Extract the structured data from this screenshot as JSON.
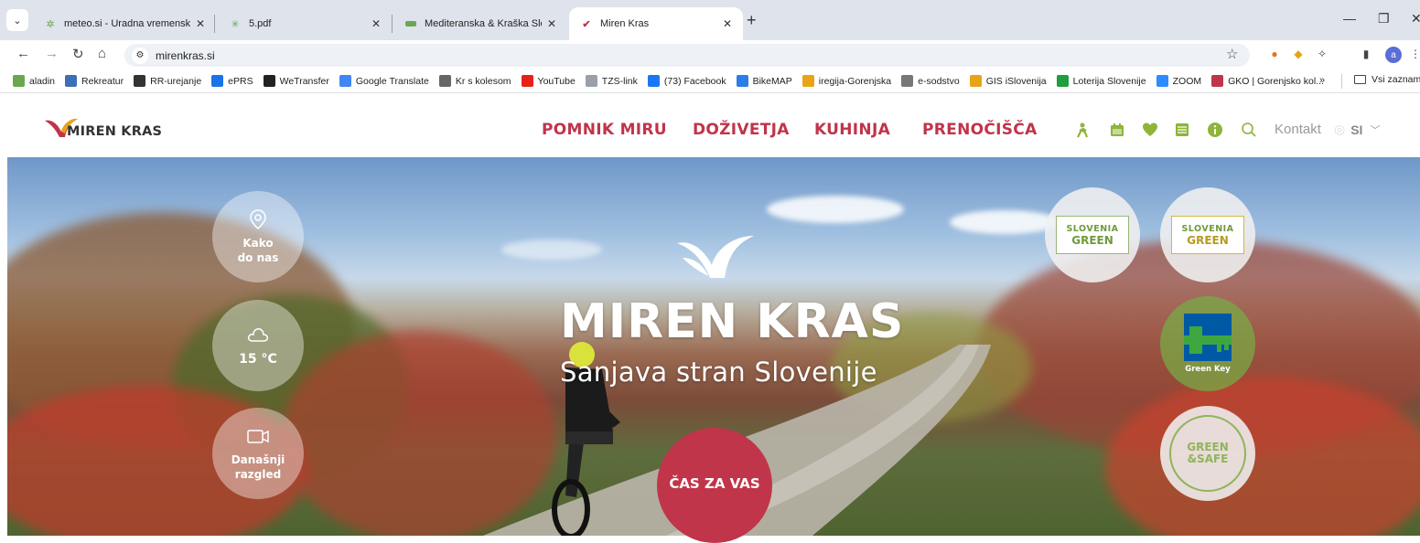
{
  "browser": {
    "tabs": [
      {
        "title": "meteo.si - Uradna vremenska n",
        "icon": "meteo-favicon"
      },
      {
        "title": "5.pdf",
        "icon": "pdf-favicon"
      },
      {
        "title": "Mediteranska & Kraška Sloven",
        "icon": "slovenia-favicon"
      },
      {
        "title": "Miren Kras",
        "icon": "miren-kras-favicon"
      }
    ],
    "url": "mirenkras.si",
    "bookmarks": [
      {
        "label": "aladin",
        "color": "#6aa84f"
      },
      {
        "label": "Rekreatur",
        "color": "#3d6fb6"
      },
      {
        "label": "RR-urejanje",
        "color": "#333333"
      },
      {
        "label": "ePRS",
        "color": "#1a73e8"
      },
      {
        "label": "WeTransfer",
        "color": "#222222"
      },
      {
        "label": "Google Translate",
        "color": "#4285f4"
      },
      {
        "label": "Kr s kolesom",
        "color": "#666666"
      },
      {
        "label": "YouTube",
        "color": "#e62117"
      },
      {
        "label": "TZS-link",
        "color": "#9aa0a6"
      },
      {
        "label": "(73) Facebook",
        "color": "#1877f2"
      },
      {
        "label": "BikeMAP",
        "color": "#2b7de9"
      },
      {
        "label": "iregija-Gorenjska",
        "color": "#e8a317"
      },
      {
        "label": "e-sodstvo",
        "color": "#777777"
      },
      {
        "label": "GIS iSlovenija",
        "color": "#e8a317"
      },
      {
        "label": "Loterija Slovenije",
        "color": "#1e9e3e"
      },
      {
        "label": "ZOOM",
        "color": "#2d8cff"
      },
      {
        "label": "GKO | Gorenjsko kol...",
        "color": "#c0354a"
      }
    ],
    "bookmarks_more": "»",
    "bookmarks_folder": "Vsi zaznamk"
  },
  "site": {
    "logo_text": "MIREN KRAS",
    "nav": [
      "POMNIK MIRU",
      "DOŽIVETJA",
      "KUHINJA",
      "PRENOČIŠČA"
    ],
    "header_icons": [
      "hiking-icon",
      "calendar-icon",
      "heart-icon",
      "menu-grid-icon",
      "info-icon",
      "search-icon"
    ],
    "kontakt": "Kontakt",
    "language": "SI",
    "brand_color": "#c0354a",
    "icon_color": "#8fb43a"
  },
  "hero": {
    "title": "MIREN KRAS",
    "subtitle": "Sanjava stran Slovenije",
    "cta": "ČAS ZA VAS",
    "left_circles": [
      {
        "label_1": "Kako",
        "label_2": "do nas",
        "icon": "map-pin-icon"
      },
      {
        "label_1": "15 °C",
        "label_2": "",
        "icon": "cloud-icon"
      },
      {
        "label_1": "Današnji",
        "label_2": "razgled",
        "icon": "video-camera-icon"
      }
    ],
    "badges": {
      "slovenia_green_1_top": "SLOVENIA",
      "slovenia_green_1_bottom": "GREEN",
      "slovenia_green_2_top": "SLOVENIA",
      "slovenia_green_2_bottom": "GREEN",
      "green_key": "Green Key",
      "green_safe_1": "GREEN",
      "green_safe_2": "&SAFE"
    }
  }
}
